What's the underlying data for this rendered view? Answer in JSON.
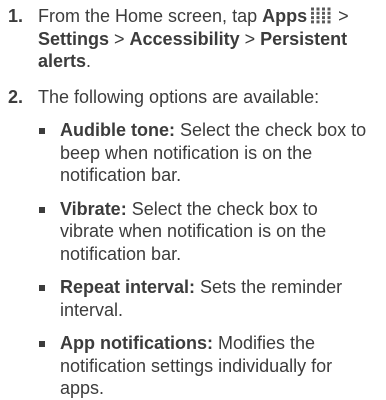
{
  "colors": {
    "text": "#3c3c3c",
    "apps_icon": "#5a5a5a"
  },
  "step1": {
    "number": "1.",
    "text_before": "From the Home screen, tap ",
    "apps_label": "Apps",
    "apps_icon": "apps-grid-icon",
    "sep1": " > ",
    "settings": "Settings",
    "sep2": " > ",
    "accessibility": "Accessibility",
    "sep3": " > ",
    "persistent_alerts": "Persistent alerts",
    "period": "."
  },
  "step2": {
    "number": "2.",
    "intro": "The following options are available:",
    "options": [
      {
        "term": "Audible tone:",
        "description": " Select the check box to beep when notification is on the notification bar."
      },
      {
        "term": "Vibrate:",
        "description": " Select the check box to vibrate when notification is on the notification bar."
      },
      {
        "term": "Repeat interval:",
        "description": " Sets the reminder interval."
      },
      {
        "term": "App notifications:",
        "description": " Modifies the notification settings individually for apps."
      }
    ]
  }
}
